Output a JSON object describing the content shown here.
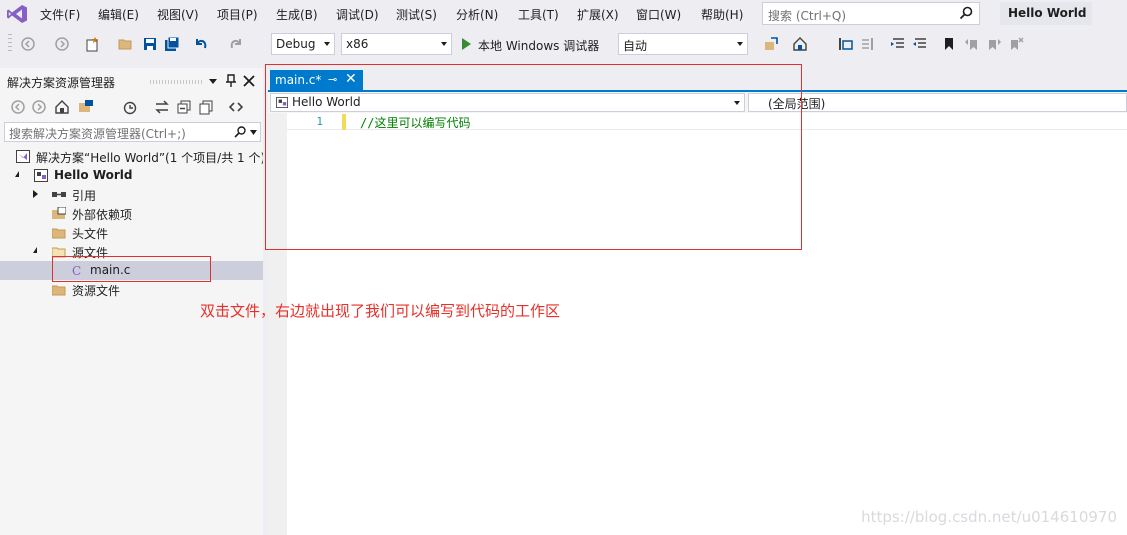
{
  "menu": [
    "文件(F)",
    "编辑(E)",
    "视图(V)",
    "项目(P)",
    "生成(B)",
    "调试(D)",
    "测试(S)",
    "分析(N)",
    "工具(T)",
    "扩展(X)",
    "窗口(W)",
    "帮助(H)"
  ],
  "search": {
    "placeholder": "搜索 (Ctrl+Q)"
  },
  "solution_title": "Hello World",
  "toolbar": {
    "config": "Debug",
    "platform": "x86",
    "run_label": "本地 Windows 调试器",
    "run_mode": "自动"
  },
  "solution_explorer": {
    "title": "解决方案资源管理器",
    "search_placeholder": "搜索解决方案资源管理器(Ctrl+;)",
    "tree": [
      {
        "label": "解决方案“Hello World”(1 个项目/共 1 个)",
        "icon": "solution-icon"
      },
      {
        "label": "Hello World",
        "icon": "cpp-project-icon",
        "bold": true
      },
      {
        "label": "引用",
        "icon": "references-icon"
      },
      {
        "label": "外部依赖项",
        "icon": "external-deps-icon"
      },
      {
        "label": "头文件",
        "icon": "folder-icon"
      },
      {
        "label": "源文件",
        "icon": "folder-icon"
      },
      {
        "label": "main.c",
        "icon": "c-file-icon",
        "selected": true
      },
      {
        "label": "资源文件",
        "icon": "folder-icon"
      }
    ]
  },
  "editor": {
    "tab_label": "main.c*",
    "nav_project": "Hello World",
    "nav_scope": "(全局范围)",
    "line_number": "1",
    "code": "//这里可以编写代码"
  },
  "annotation": "双击文件，右边就出现了我们可以编写到代码的工作区",
  "watermark": "https://blog.csdn.net/u014610970",
  "colors": {
    "accent": "#007acc",
    "annotation": "#e8302a",
    "comment": "#008000"
  }
}
